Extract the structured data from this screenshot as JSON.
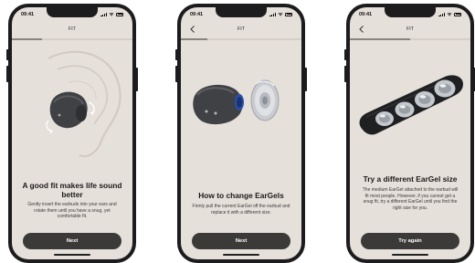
{
  "screens": [
    {
      "status_time": "09:41",
      "nav_title": "FIT",
      "has_back": false,
      "progress": 0.25,
      "title": "A good fit makes life sound better",
      "body": "Gently insert the earbuds into your ears and rotate them until you have a snug, yet comfortable fit.",
      "button_label": "Next"
    },
    {
      "status_time": "09:41",
      "nav_title": "FIT",
      "has_back": true,
      "progress": 0.22,
      "title": "How to change EarGels",
      "body": "Firmly pull the current EarGel off the earbud and replace it with a different size.",
      "button_label": "Next"
    },
    {
      "status_time": "09:41",
      "nav_title": "FIT",
      "has_back": true,
      "progress": 0.5,
      "title": "Try a different EarGel size",
      "body": "The medium EarGel attached to the earbud will fit most people. However, if you cannot get a snug fit, try a different EarGel until you find the right size for you.",
      "button_label": "Try again"
    }
  ],
  "icons": {
    "back": "chevron-left-icon",
    "signal": "signal-icon",
    "wifi": "wifi-icon",
    "battery": "battery-icon"
  },
  "colors": {
    "screen_bg": "#e6e0da",
    "button_bg": "#3b3a38",
    "earbud": "#3f4144",
    "accent_blue": "#2a4fa8"
  }
}
